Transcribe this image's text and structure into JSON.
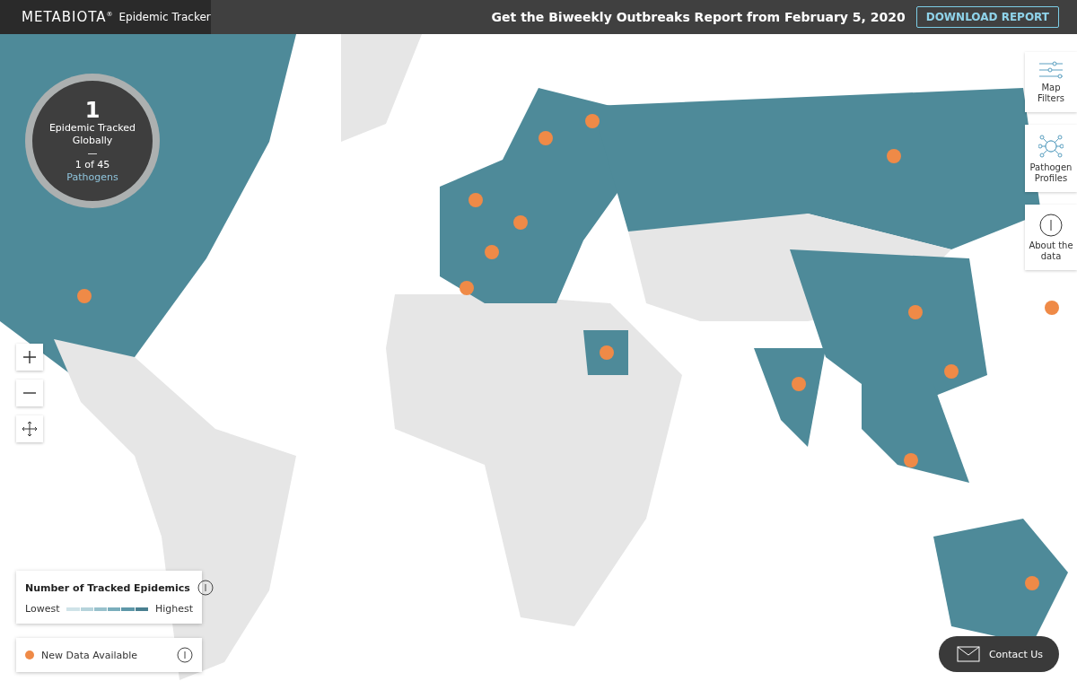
{
  "header": {
    "brand": "METABIOTA",
    "brand_mark": "®",
    "product": "Epidemic Tracker",
    "promo": "Get the Biweekly Outbreaks Report from February 5, 2020",
    "button": "DOWNLOAD REPORT"
  },
  "summary": {
    "count": "1",
    "label": "Epidemic Tracked Globally",
    "separator": "—",
    "ratio": "1 of 45",
    "link": "Pathogens"
  },
  "zoom_controls": [
    {
      "kind": "zoom-in"
    },
    {
      "kind": "zoom-out"
    },
    {
      "kind": "pan"
    }
  ],
  "side_panel": [
    {
      "kind": "filters",
      "label": "Map Filters"
    },
    {
      "kind": "pathogens",
      "label": "Pathogen Profiles"
    },
    {
      "kind": "about",
      "label": "About the data"
    }
  ],
  "legend": {
    "title": "Number of Tracked Epidemics",
    "low": "Lowest",
    "high": "Highest",
    "steps": [
      {
        "color": "#cfe3e8"
      },
      {
        "color": "#b5d3db"
      },
      {
        "color": "#98c1cc"
      },
      {
        "color": "#7aaebc"
      },
      {
        "color": "#5d97a8"
      },
      {
        "color": "#497f90"
      }
    ]
  },
  "new_data": {
    "label": "New Data Available",
    "color": "#ef8a47"
  },
  "contact": {
    "label": "Contact Us"
  }
}
